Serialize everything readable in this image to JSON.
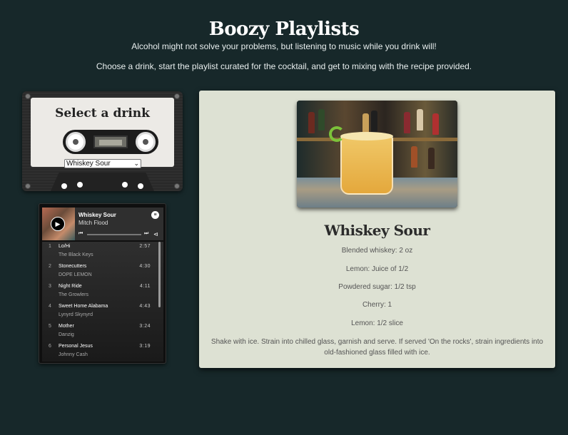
{
  "header": {
    "title": "Boozy Playlists",
    "subtitle": "Alcohol might not solve your problems, but listening to music while you drink will!",
    "instructions": "Choose a drink, start the playlist curated for the cocktail, and get to mixing with the recipe provided."
  },
  "selector": {
    "title": "Select a drink",
    "selected": "Whiskey Sour"
  },
  "playlist": {
    "title": "Whiskey Sour",
    "owner": "Mitch Flood",
    "tracks": [
      {
        "num": "1",
        "name": "Lo/Hi",
        "artist": "The Black Keys",
        "duration": "2:57"
      },
      {
        "num": "2",
        "name": "Stonecutters",
        "artist": "DOPE LEMON",
        "duration": "4:30"
      },
      {
        "num": "3",
        "name": "Night Ride",
        "artist": "The Growlers",
        "duration": "4:11"
      },
      {
        "num": "4",
        "name": "Sweet Home Alabama",
        "artist": "Lynyrd Skynyrd",
        "duration": "4:43"
      },
      {
        "num": "5",
        "name": "Mother",
        "artist": "Danzig",
        "duration": "3:24"
      },
      {
        "num": "6",
        "name": "Personal Jesus",
        "artist": "Johnny Cash",
        "duration": "3:19"
      }
    ]
  },
  "recipe": {
    "name": "Whiskey Sour",
    "ingredients": [
      "Blended whiskey: 2 oz",
      "Lemon: Juice of 1/2",
      "Powdered sugar: 1/2 tsp",
      "Cherry: 1",
      "Lemon: 1/2 slice"
    ],
    "instructions": "Shake with ice. Strain into chilled glass, garnish and serve. If served 'On the rocks', strain ingredients into old-fashioned glass filled with ice."
  },
  "colors": {
    "background": "#17282a",
    "panel": "#dde1d3",
    "cassette": "#2b2b2b"
  }
}
